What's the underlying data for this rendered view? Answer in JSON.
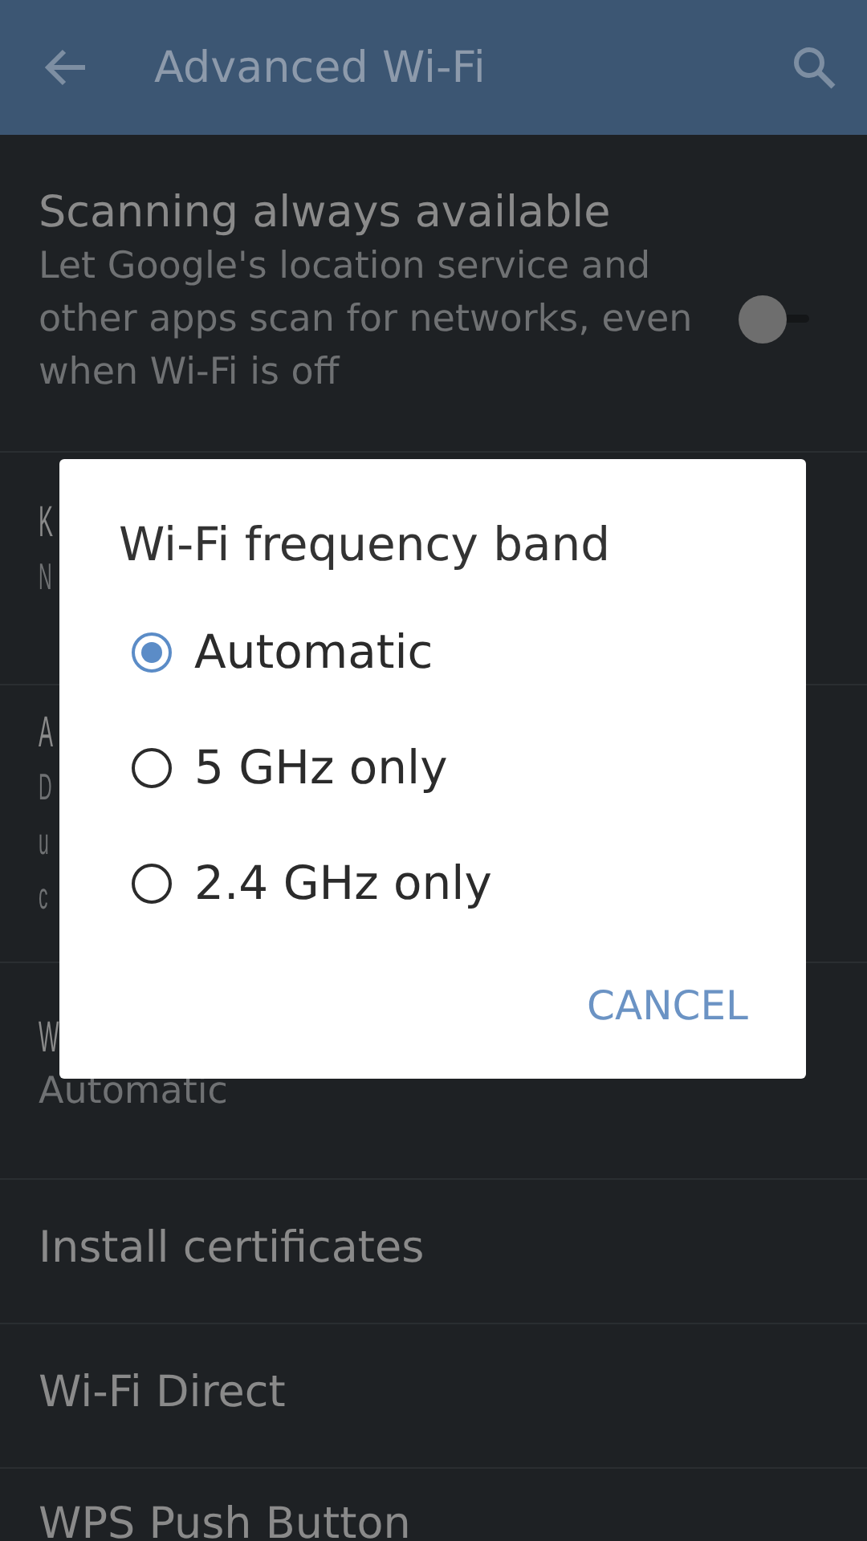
{
  "app_bar": {
    "title": "Advanced Wi-Fi"
  },
  "settings": [
    {
      "kind": "switch",
      "title": "Scanning always available",
      "summary": "Let Google's location service and other apps scan for networks, even when Wi-Fi is off",
      "on": false
    },
    {
      "kind": "covered",
      "title": "K",
      "summary_lines": [
        "N"
      ]
    },
    {
      "kind": "covered",
      "title": "A",
      "summary_lines": [
        "D",
        "u",
        "c"
      ]
    },
    {
      "kind": "covered",
      "title": "W",
      "summary_lines": [
        "Automatic"
      ]
    },
    {
      "kind": "plain",
      "title": "Install certificates"
    },
    {
      "kind": "plain",
      "title": "Wi-Fi Direct"
    },
    {
      "kind": "plain",
      "title": "WPS Push Button"
    }
  ],
  "dialog": {
    "title": "Wi-Fi frequency band",
    "options": [
      {
        "label": "Automatic",
        "selected": true
      },
      {
        "label": "5 GHz only",
        "selected": false
      },
      {
        "label": "2.4 GHz only",
        "selected": false
      }
    ],
    "buttons": [
      "CANCEL"
    ]
  }
}
